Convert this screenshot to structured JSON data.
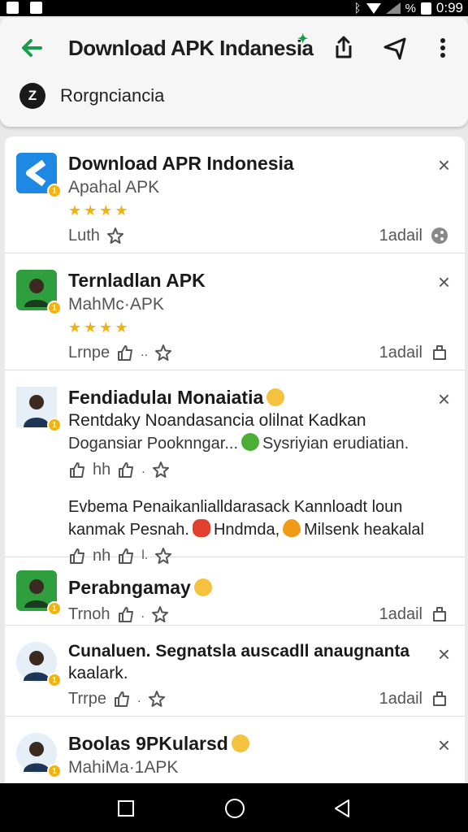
{
  "status_bar": {
    "time": "0:99"
  },
  "header": {
    "title": "Download APK Indanesia",
    "account_initial": "Z",
    "account_name": "Rorgnciancia"
  },
  "items": [
    {
      "title": "Download APR Indonesia",
      "subtitle": "Apahal APK",
      "stars": "★★★★",
      "meta_left": "Luth",
      "meta_right": "1adail",
      "icon_bg": "#1e88e5"
    },
    {
      "title": "Ternladlan APK",
      "subtitle": "MahMc·APK",
      "stars": "★★★★",
      "meta_left": "Lrnpe",
      "meta_right": "1adail",
      "icon_bg": "#2e9e3e"
    },
    {
      "title": "Fendiadulaı Monaiatia",
      "line2": "Rentdaky Noandasancia olilnat Kadkan",
      "line3a": "Dogansiar Pooknngar...",
      "line3b": "Sysriyian erudiatian.",
      "meta_left": "hh",
      "para_a": "Evbema Penaikanlialldarasack Kannloadt loun",
      "para_b1": "kanmak Pesnah.",
      "para_b2": "Hndmda,",
      "para_b3": "Milsenk heakalal",
      "meta2_left": "nh",
      "icon_bg": "#1e88e5"
    },
    {
      "title": "Perabngamay",
      "meta_left": "Trnoh",
      "meta_right": "1adail",
      "icon_bg": "#2e9e3e"
    },
    {
      "title": "Cunaluen. Segnatsla auscadll anaugnanta",
      "title2": "kaalark.",
      "meta_left": "Trrpe",
      "meta_right": "1adail"
    },
    {
      "title": "Boolas 9PKularsd",
      "subtitle": "MahiMa·1APK"
    }
  ],
  "colors": {
    "accent_green": "#1a9e4b",
    "star": "#f2b312"
  }
}
